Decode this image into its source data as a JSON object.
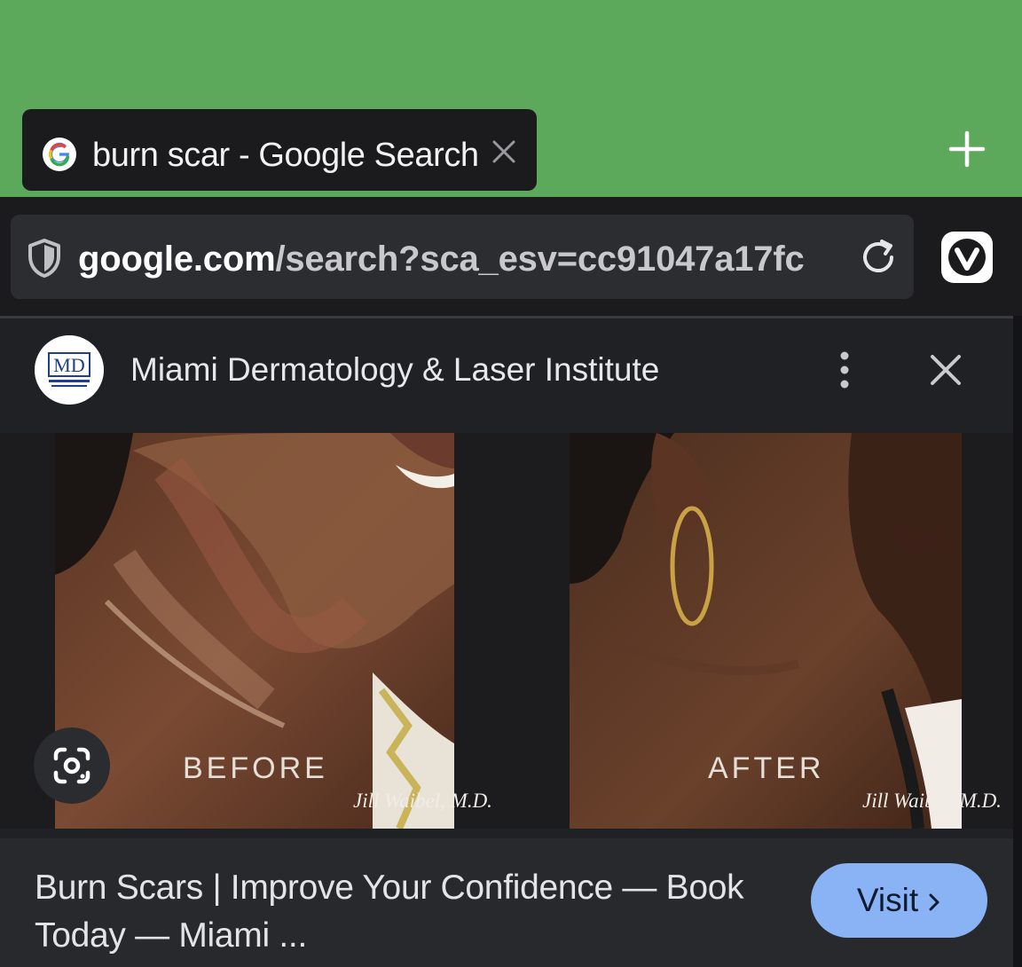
{
  "browser": {
    "tab": {
      "title": "burn scar - Google Search",
      "favicon": "google-g-icon"
    },
    "address_bar": {
      "host": "google.com",
      "path": "/search?sca_esv=cc91047a17fc",
      "security_icon": "shield-icon"
    },
    "icons": [
      "close-icon",
      "plus-icon",
      "reload-icon",
      "vivaldi-icon"
    ]
  },
  "viewer": {
    "source_name": "Miami Dermatology & Laser Institute",
    "source_logo_text": "MD",
    "image": {
      "label_before": "BEFORE",
      "label_after": "AFTER",
      "signature_1": "Jill Waibel, M.D.",
      "signature_2": "Jill Waibel, M.D."
    },
    "result_title": "Burn Scars | Improve Your Confidence — Book Today — Miami ...",
    "visit_label": "Visit"
  },
  "colors": {
    "top_bar": "#5da95c",
    "visit_button": "#8ab3f5",
    "dark_bg": "#1f2023"
  }
}
